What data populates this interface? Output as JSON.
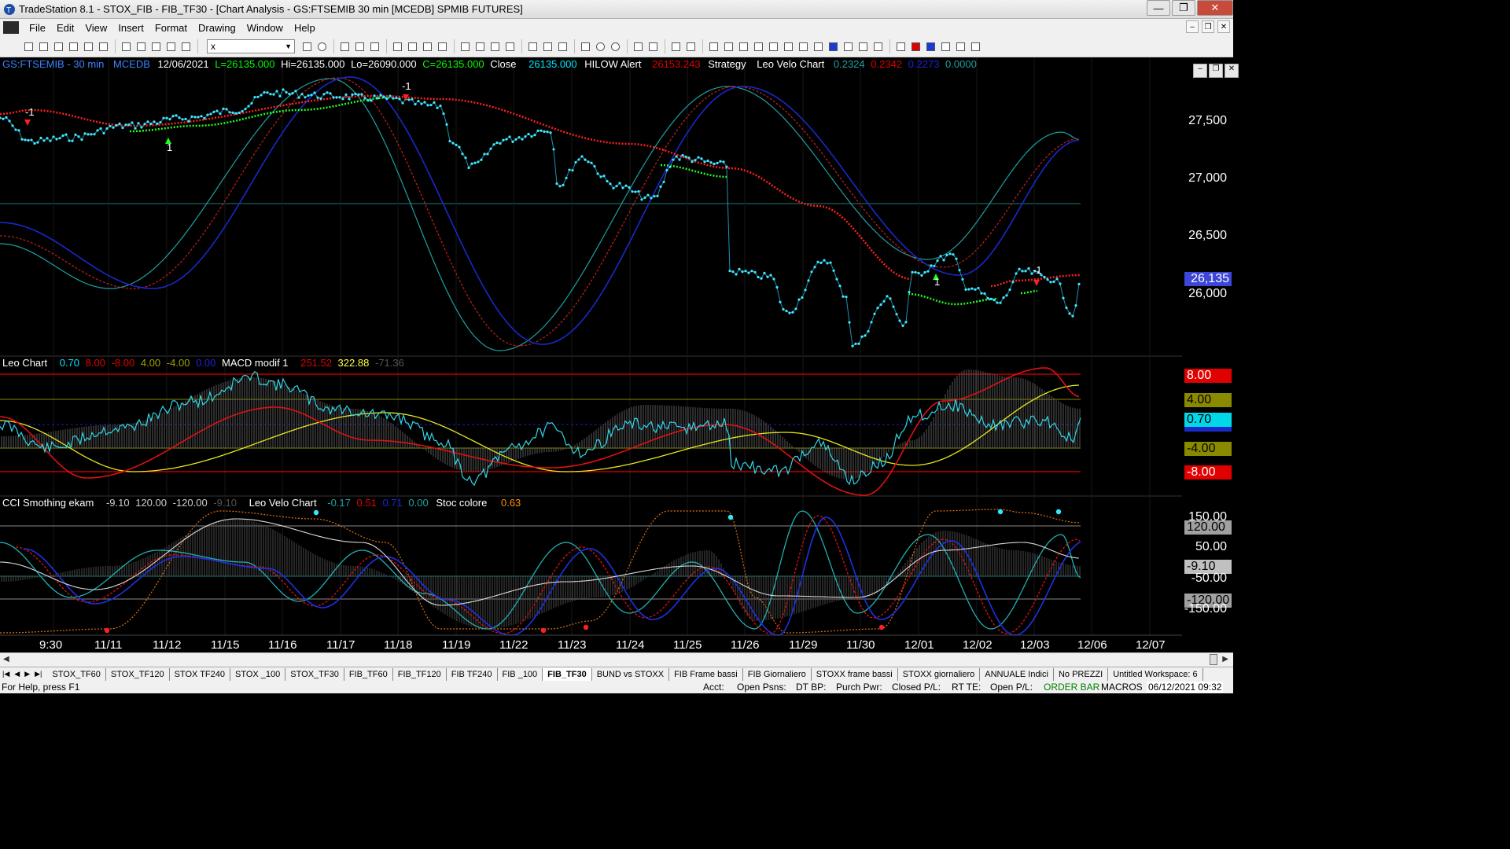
{
  "window": {
    "title": "TradeStation 8.1 - STOX_FIB - FIB_TF30 - [Chart Analysis - GS:FTSEMIB  30 min  [MCEDB] SPMIB FUTURES]"
  },
  "menu": [
    "File",
    "Edit",
    "View",
    "Insert",
    "Format",
    "Drawing",
    "Window",
    "Help"
  ],
  "toolbar": {
    "symbol_value": "x"
  },
  "panel1": {
    "symbol": "GS:FTSEMIB - 30 min",
    "feed": "MCEDB",
    "date": "12/06/2021",
    "last": "L=26135.000",
    "hi": "Hi=26135.000",
    "lo": "Lo=26090.000",
    "close": "C=26135.000",
    "close_label": "Close",
    "close_val": "26135.000",
    "hilow": "HILOW Alert",
    "hilow_val": "26153.243",
    "strategy": "Strategy",
    "leovelo": "Leo Velo Chart",
    "v1": "0.2324",
    "v2": "0.2342",
    "v3": "0.2273",
    "v4": "0.0000",
    "axis": [
      "27,500",
      "27,000",
      "26,500",
      "26,000"
    ],
    "current_price": "26,135",
    "marks": [
      "-1",
      "-1",
      "1",
      "1",
      "-1"
    ]
  },
  "panel2": {
    "title": "Leo Chart",
    "a": "0.70",
    "b": "8.00",
    "c": "-8.00",
    "d": "4.00",
    "e": "-4.00",
    "f": "0.00",
    "macd": "MACD modif 1",
    "m1": "251.52",
    "m2": "322.88",
    "m3": "-71.36",
    "axis": [
      "8.00",
      "4.00",
      "0.70",
      "-4.00",
      "-8.00"
    ]
  },
  "panel3": {
    "title": "CCI Smothing ekam",
    "a": "-9.10",
    "b": "120.00",
    "c": "-120.00",
    "d": "-9.10",
    "leovelo": "Leo Velo Chart",
    "v1": "-0.17",
    "v2": "0.51",
    "v3": "0.71",
    "v4": "0.00",
    "stoc": "Stoc colore",
    "s1": "0.63",
    "axis": [
      "150.00",
      "120.00",
      "50.00",
      "-9.10",
      "-50.00",
      "-120.00",
      "-150.00"
    ]
  },
  "dates": [
    "9:30",
    "11/11",
    "11/12",
    "11/15",
    "11/16",
    "11/17",
    "11/18",
    "11/19",
    "11/22",
    "11/23",
    "11/24",
    "11/25",
    "11/26",
    "11/29",
    "11/30",
    "12/01",
    "12/02",
    "12/03",
    "12/06",
    "12/07"
  ],
  "tabs": [
    "STOX_TF60",
    "STOX_TF120",
    "STOX TF240",
    "STOX _100",
    "STOX_TF30",
    "FIB_TF60",
    "FIB_TF120",
    "FIB TF240",
    "FIB _100",
    "FIB_TF30",
    "BUND vs STOXX",
    "FIB Frame bassi",
    "FIB Giornaliero",
    "STOXX frame bassi",
    "STOXX giornaliero",
    "ANNUALE Indici",
    "No PREZZI",
    "Untitled Workspace:  6"
  ],
  "active_tab": "FIB_TF30",
  "status": {
    "help": "For Help, press F1",
    "acct": "Acct:",
    "open_psns": "Open Psns:",
    "dt_bp": "DT BP:",
    "purch_pwr": "Purch Pwr:",
    "closed_pl": "Closed P/L:",
    "rt_te": "RT TE:",
    "open_pl": "Open P/L:",
    "order_bar": "ORDER BAR",
    "macros": "MACROS",
    "datetime": "06/12/2021 09:32"
  }
}
